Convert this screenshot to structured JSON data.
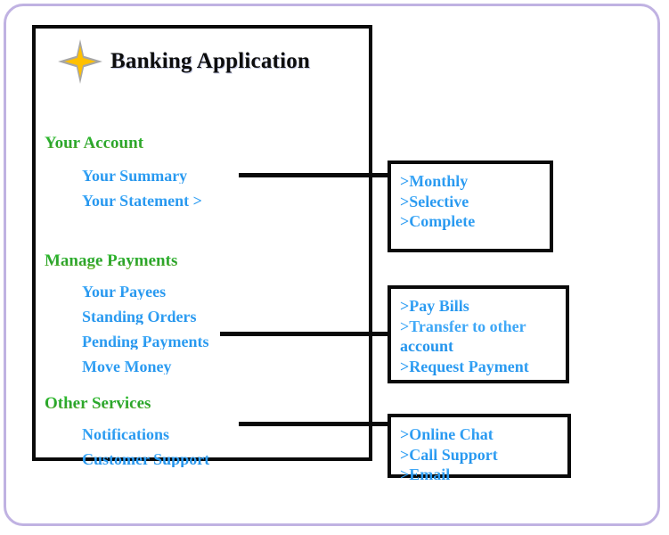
{
  "app": {
    "title": "Banking Application",
    "logo_icon": "four-pointed-star-icon",
    "colors": {
      "frame": "#c0b2e2",
      "box_border": "#0a0a0a",
      "section_header": "#2aa12a",
      "menu_item": "#2d9cf0",
      "title": "#0d0d0d",
      "star_outer": "#a6a6a6",
      "star_inner": "#ffc000"
    }
  },
  "menu": {
    "sections": [
      {
        "header": "Your Account",
        "items": [
          {
            "label": "Your Summary",
            "has_submenu": false
          },
          {
            "label": "Your Statement >",
            "has_submenu": true
          }
        ]
      },
      {
        "header": "Manage Payments",
        "items": [
          {
            "label": "Your Payees",
            "has_submenu": false
          },
          {
            "label": "Standing Orders",
            "has_submenu": false
          },
          {
            "label": "Pending Payments",
            "has_submenu": false
          },
          {
            "label": "Move Money",
            "has_submenu": true
          }
        ]
      },
      {
        "header": "Other Services",
        "items": [
          {
            "label": "Notifications",
            "has_submenu": false
          },
          {
            "label": "Customer Support",
            "has_submenu": true
          }
        ]
      }
    ]
  },
  "submenus": [
    {
      "id": "statement",
      "parent": "Your Statement >",
      "entries": [
        ">Monthly",
        ">Selective",
        ">Complete"
      ]
    },
    {
      "id": "movemoney",
      "parent": "Move Money",
      "entries": [
        ">Pay Bills",
        ">Transfer to other account",
        ">Request Payment"
      ]
    },
    {
      "id": "support",
      "parent": "Customer Support",
      "entries": [
        ">Online Chat",
        ">Call Support",
        ">Email"
      ]
    }
  ]
}
